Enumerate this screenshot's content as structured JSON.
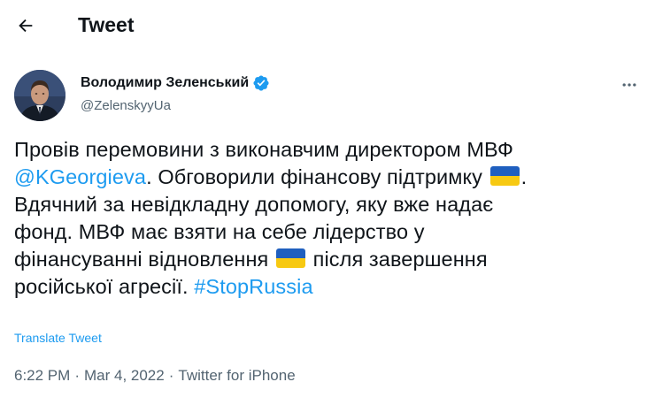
{
  "header": {
    "title": "Tweet"
  },
  "author": {
    "display_name": "Володимир Зеленський",
    "handle": "@ZelenskyyUa"
  },
  "tweet": {
    "line1": "Провів перемовини з виконавчим директором МВФ",
    "mention": "@KGeorgieva",
    "line2_after_mention": ". Обговорили фінансову підтримку",
    "line2_end": ".",
    "line3": "Вдячний за невідкладну допомогу, яку вже надає",
    "line4": "фонд. МВФ має взяти на себе лідерство у",
    "line5_start": "фінансуванні відновлення",
    "line5_end": "після завершення",
    "line6_start": "російської агресії.",
    "hashtag": "#StopRussia"
  },
  "translate_label": "Translate Tweet",
  "meta": {
    "time": "6:22 PM",
    "separator": "·",
    "date": "Mar 4, 2022",
    "source": "Twitter for iPhone"
  },
  "icons": {
    "back": "arrow-left-icon",
    "verified": "verified-badge-icon",
    "more": "more-dots-icon",
    "flag": "ukraine-flag-emoji"
  },
  "colors": {
    "accent": "#1d9bf0",
    "text": "#0f1419",
    "secondary": "#536471",
    "flag_blue": "#1f5fbf",
    "flag_yellow": "#f7c912"
  }
}
